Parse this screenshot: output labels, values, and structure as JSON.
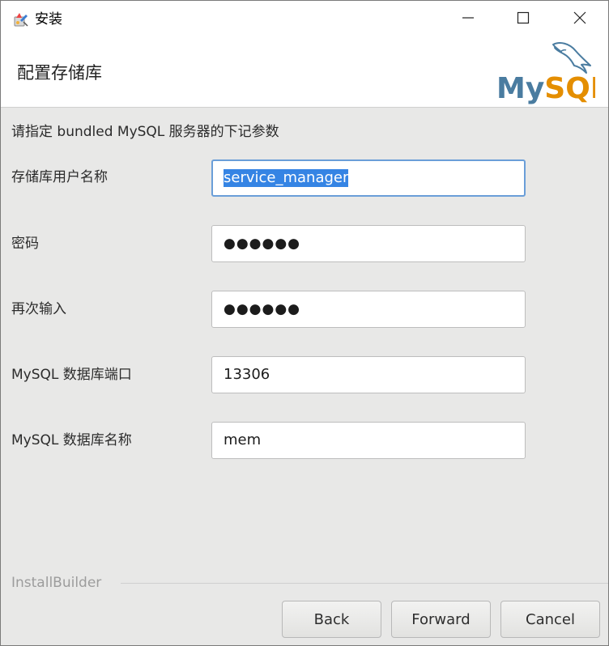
{
  "window": {
    "title": "安装",
    "icons": {
      "app": "installer-icon",
      "minimize": "minimize-icon",
      "maximize": "maximize-icon",
      "close": "close-icon"
    }
  },
  "header": {
    "title": "配置存储库",
    "logo_text": "MySQL",
    "logo_mark": "dolphin-icon",
    "brand_colors": {
      "my": "#4a7ca0",
      "sql": "#e48e00"
    }
  },
  "form": {
    "intro": "请指定 bundled MySQL 服务器的下记参数",
    "fields": [
      {
        "label": "存储库用户名称",
        "value": "service_manager",
        "type": "text",
        "focused": true,
        "selected": true
      },
      {
        "label": "密码",
        "value": "●●●●●●",
        "type": "password"
      },
      {
        "label": "再次输入",
        "value": "●●●●●●",
        "type": "password"
      },
      {
        "label": "MySQL 数据库端口",
        "value": "13306",
        "type": "text"
      },
      {
        "label": "MySQL 数据库名称",
        "value": "mem",
        "type": "text"
      }
    ]
  },
  "footer": {
    "brand": "InstallBuilder",
    "buttons": {
      "back": "Back",
      "forward": "Forward",
      "cancel": "Cancel"
    }
  }
}
